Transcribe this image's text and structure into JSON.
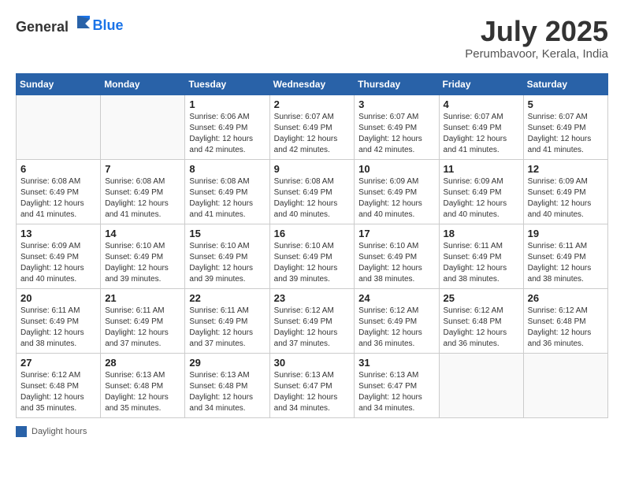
{
  "header": {
    "logo_general": "General",
    "logo_blue": "Blue",
    "month": "July 2025",
    "location": "Perumbavoor, Kerala, India"
  },
  "weekdays": [
    "Sunday",
    "Monday",
    "Tuesday",
    "Wednesday",
    "Thursday",
    "Friday",
    "Saturday"
  ],
  "legend": "Daylight hours",
  "weeks": [
    [
      {
        "day": "",
        "sunrise": "",
        "sunset": "",
        "daylight": ""
      },
      {
        "day": "",
        "sunrise": "",
        "sunset": "",
        "daylight": ""
      },
      {
        "day": "1",
        "sunrise": "Sunrise: 6:06 AM",
        "sunset": "Sunset: 6:49 PM",
        "daylight": "Daylight: 12 hours and 42 minutes."
      },
      {
        "day": "2",
        "sunrise": "Sunrise: 6:07 AM",
        "sunset": "Sunset: 6:49 PM",
        "daylight": "Daylight: 12 hours and 42 minutes."
      },
      {
        "day": "3",
        "sunrise": "Sunrise: 6:07 AM",
        "sunset": "Sunset: 6:49 PM",
        "daylight": "Daylight: 12 hours and 42 minutes."
      },
      {
        "day": "4",
        "sunrise": "Sunrise: 6:07 AM",
        "sunset": "Sunset: 6:49 PM",
        "daylight": "Daylight: 12 hours and 41 minutes."
      },
      {
        "day": "5",
        "sunrise": "Sunrise: 6:07 AM",
        "sunset": "Sunset: 6:49 PM",
        "daylight": "Daylight: 12 hours and 41 minutes."
      }
    ],
    [
      {
        "day": "6",
        "sunrise": "Sunrise: 6:08 AM",
        "sunset": "Sunset: 6:49 PM",
        "daylight": "Daylight: 12 hours and 41 minutes."
      },
      {
        "day": "7",
        "sunrise": "Sunrise: 6:08 AM",
        "sunset": "Sunset: 6:49 PM",
        "daylight": "Daylight: 12 hours and 41 minutes."
      },
      {
        "day": "8",
        "sunrise": "Sunrise: 6:08 AM",
        "sunset": "Sunset: 6:49 PM",
        "daylight": "Daylight: 12 hours and 41 minutes."
      },
      {
        "day": "9",
        "sunrise": "Sunrise: 6:08 AM",
        "sunset": "Sunset: 6:49 PM",
        "daylight": "Daylight: 12 hours and 40 minutes."
      },
      {
        "day": "10",
        "sunrise": "Sunrise: 6:09 AM",
        "sunset": "Sunset: 6:49 PM",
        "daylight": "Daylight: 12 hours and 40 minutes."
      },
      {
        "day": "11",
        "sunrise": "Sunrise: 6:09 AM",
        "sunset": "Sunset: 6:49 PM",
        "daylight": "Daylight: 12 hours and 40 minutes."
      },
      {
        "day": "12",
        "sunrise": "Sunrise: 6:09 AM",
        "sunset": "Sunset: 6:49 PM",
        "daylight": "Daylight: 12 hours and 40 minutes."
      }
    ],
    [
      {
        "day": "13",
        "sunrise": "Sunrise: 6:09 AM",
        "sunset": "Sunset: 6:49 PM",
        "daylight": "Daylight: 12 hours and 40 minutes."
      },
      {
        "day": "14",
        "sunrise": "Sunrise: 6:10 AM",
        "sunset": "Sunset: 6:49 PM",
        "daylight": "Daylight: 12 hours and 39 minutes."
      },
      {
        "day": "15",
        "sunrise": "Sunrise: 6:10 AM",
        "sunset": "Sunset: 6:49 PM",
        "daylight": "Daylight: 12 hours and 39 minutes."
      },
      {
        "day": "16",
        "sunrise": "Sunrise: 6:10 AM",
        "sunset": "Sunset: 6:49 PM",
        "daylight": "Daylight: 12 hours and 39 minutes."
      },
      {
        "day": "17",
        "sunrise": "Sunrise: 6:10 AM",
        "sunset": "Sunset: 6:49 PM",
        "daylight": "Daylight: 12 hours and 38 minutes."
      },
      {
        "day": "18",
        "sunrise": "Sunrise: 6:11 AM",
        "sunset": "Sunset: 6:49 PM",
        "daylight": "Daylight: 12 hours and 38 minutes."
      },
      {
        "day": "19",
        "sunrise": "Sunrise: 6:11 AM",
        "sunset": "Sunset: 6:49 PM",
        "daylight": "Daylight: 12 hours and 38 minutes."
      }
    ],
    [
      {
        "day": "20",
        "sunrise": "Sunrise: 6:11 AM",
        "sunset": "Sunset: 6:49 PM",
        "daylight": "Daylight: 12 hours and 38 minutes."
      },
      {
        "day": "21",
        "sunrise": "Sunrise: 6:11 AM",
        "sunset": "Sunset: 6:49 PM",
        "daylight": "Daylight: 12 hours and 37 minutes."
      },
      {
        "day": "22",
        "sunrise": "Sunrise: 6:11 AM",
        "sunset": "Sunset: 6:49 PM",
        "daylight": "Daylight: 12 hours and 37 minutes."
      },
      {
        "day": "23",
        "sunrise": "Sunrise: 6:12 AM",
        "sunset": "Sunset: 6:49 PM",
        "daylight": "Daylight: 12 hours and 37 minutes."
      },
      {
        "day": "24",
        "sunrise": "Sunrise: 6:12 AM",
        "sunset": "Sunset: 6:49 PM",
        "daylight": "Daylight: 12 hours and 36 minutes."
      },
      {
        "day": "25",
        "sunrise": "Sunrise: 6:12 AM",
        "sunset": "Sunset: 6:48 PM",
        "daylight": "Daylight: 12 hours and 36 minutes."
      },
      {
        "day": "26",
        "sunrise": "Sunrise: 6:12 AM",
        "sunset": "Sunset: 6:48 PM",
        "daylight": "Daylight: 12 hours and 36 minutes."
      }
    ],
    [
      {
        "day": "27",
        "sunrise": "Sunrise: 6:12 AM",
        "sunset": "Sunset: 6:48 PM",
        "daylight": "Daylight: 12 hours and 35 minutes."
      },
      {
        "day": "28",
        "sunrise": "Sunrise: 6:13 AM",
        "sunset": "Sunset: 6:48 PM",
        "daylight": "Daylight: 12 hours and 35 minutes."
      },
      {
        "day": "29",
        "sunrise": "Sunrise: 6:13 AM",
        "sunset": "Sunset: 6:48 PM",
        "daylight": "Daylight: 12 hours and 34 minutes."
      },
      {
        "day": "30",
        "sunrise": "Sunrise: 6:13 AM",
        "sunset": "Sunset: 6:47 PM",
        "daylight": "Daylight: 12 hours and 34 minutes."
      },
      {
        "day": "31",
        "sunrise": "Sunrise: 6:13 AM",
        "sunset": "Sunset: 6:47 PM",
        "daylight": "Daylight: 12 hours and 34 minutes."
      },
      {
        "day": "",
        "sunrise": "",
        "sunset": "",
        "daylight": ""
      },
      {
        "day": "",
        "sunrise": "",
        "sunset": "",
        "daylight": ""
      }
    ]
  ]
}
